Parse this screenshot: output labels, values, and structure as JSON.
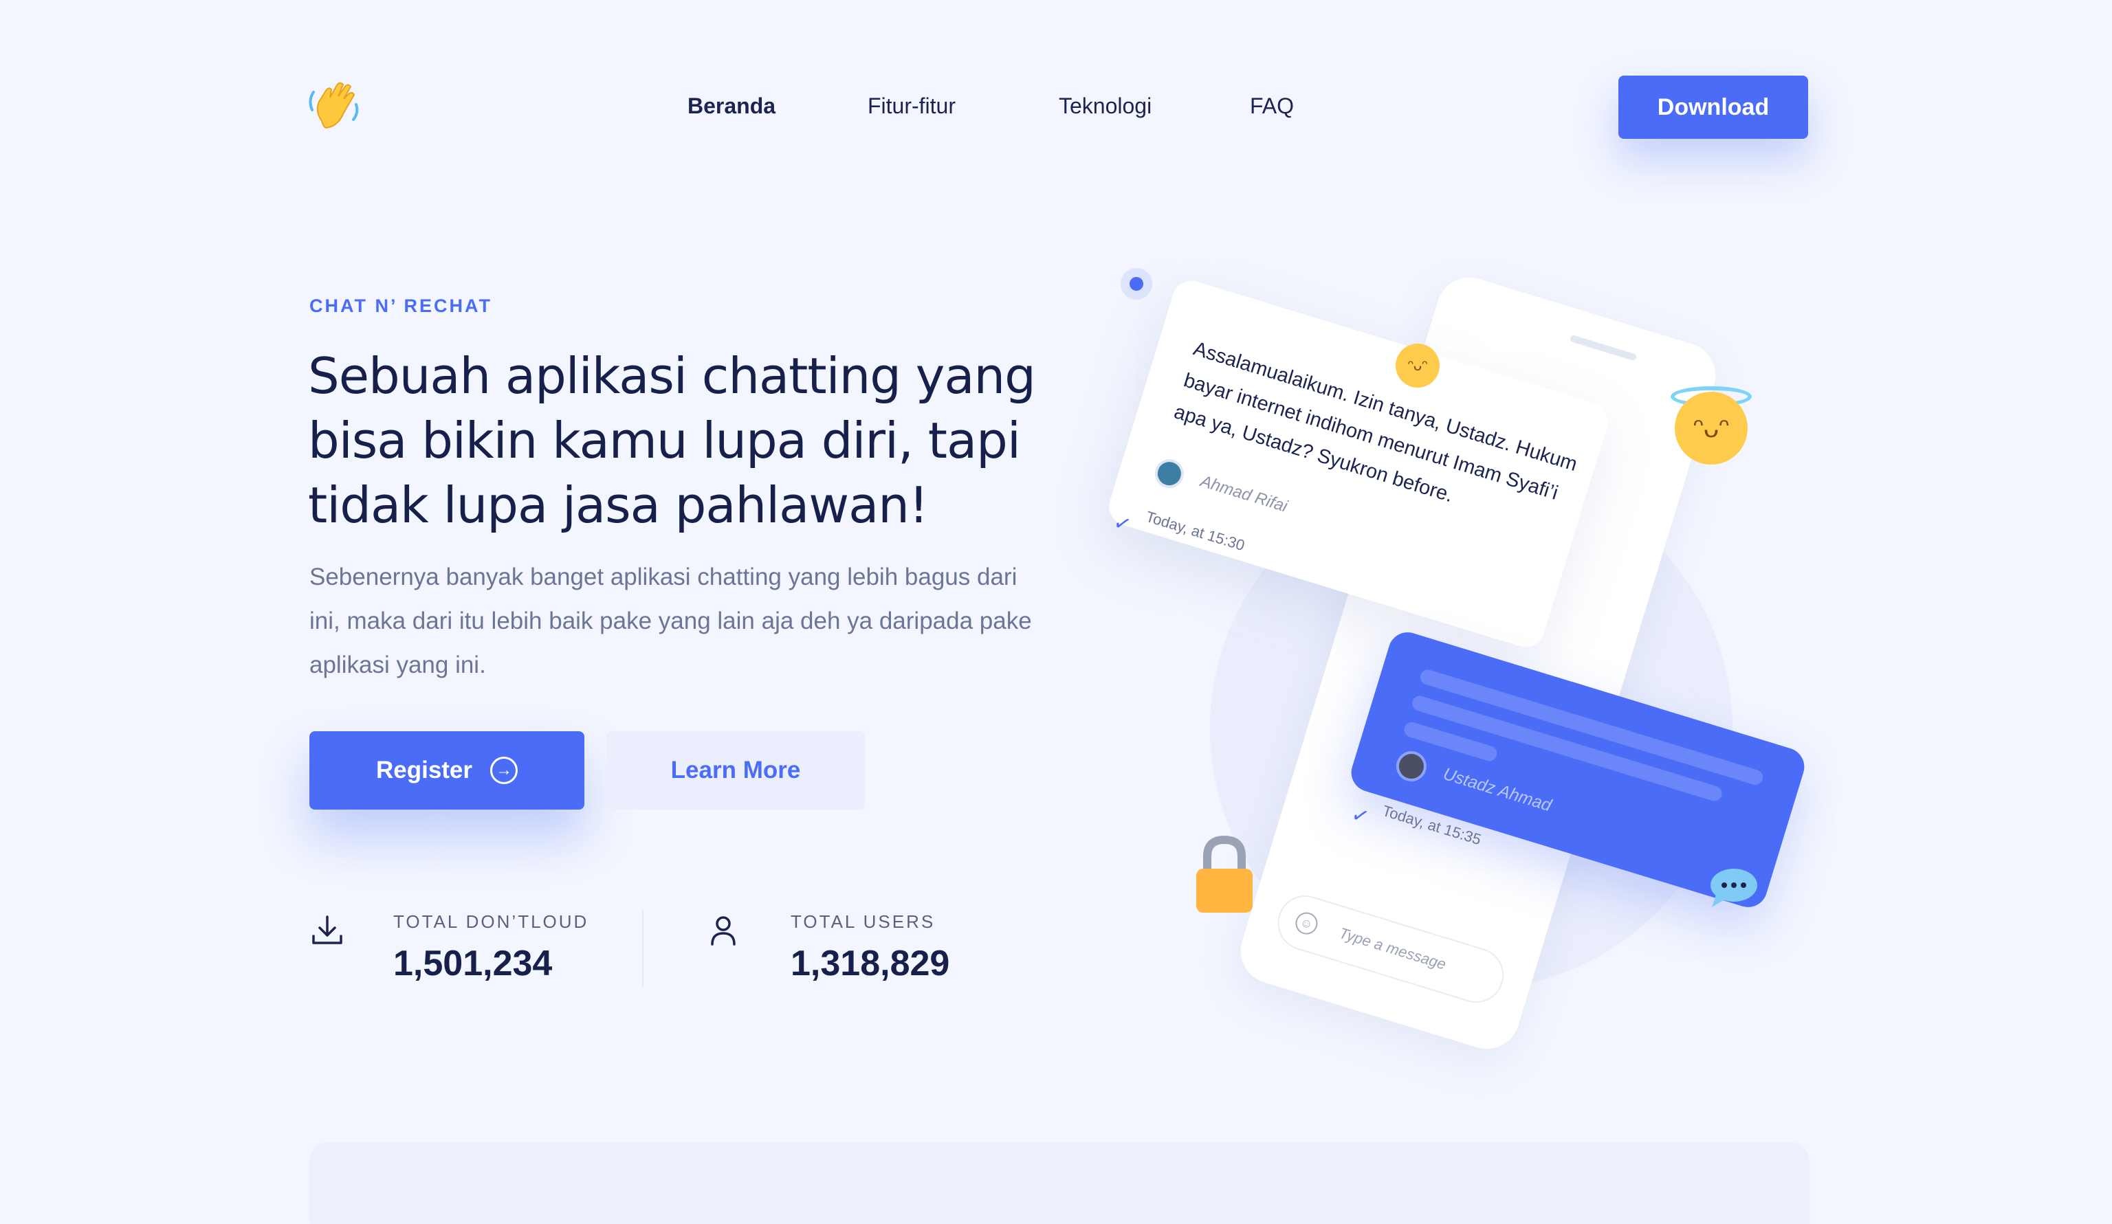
{
  "nav": {
    "logo_icon": "waving-hand-icon",
    "links": [
      "Beranda",
      "Fitur-fitur",
      "Teknologi",
      "FAQ"
    ],
    "active_link": "Beranda",
    "download_label": "Download"
  },
  "hero": {
    "eyebrow": "CHAT N’ RECHAT",
    "headline": "Sebuah aplikasi chatting yang bisa bikin kamu lupa diri, tapi tidak lupa jasa pahlawan!",
    "description": "Sebenernya banyak banget aplikasi chatting yang lebih bagus dari ini, maka dari itu lebih baik pake yang lain aja deh ya daripada pake aplikasi yang ini.",
    "register_label": "Register",
    "register_icon": "arrow-right-circle-icon",
    "learn_more_label": "Learn More"
  },
  "stats": [
    {
      "icon": "download-icon",
      "label": "TOTAL DON’TLOUD",
      "value": "1,501,234"
    },
    {
      "icon": "user-icon",
      "label": "TOTAL USERS",
      "value": "1,318,829"
    }
  ],
  "illustration": {
    "message1": {
      "text": "Assalamualaikum. Izin tanya, Ustadz. Hukum bayar internet indihom menurut Imam Syafi’i apa ya, Ustadz? Syukron before.",
      "sender": "Ahmad Rifai",
      "time": "Today, at 15:30"
    },
    "message2": {
      "sender": "Ustadz Ahmad",
      "time": "Today, at 15:35"
    },
    "input_placeholder": "Type a message",
    "accent": "#4a6cf7"
  }
}
